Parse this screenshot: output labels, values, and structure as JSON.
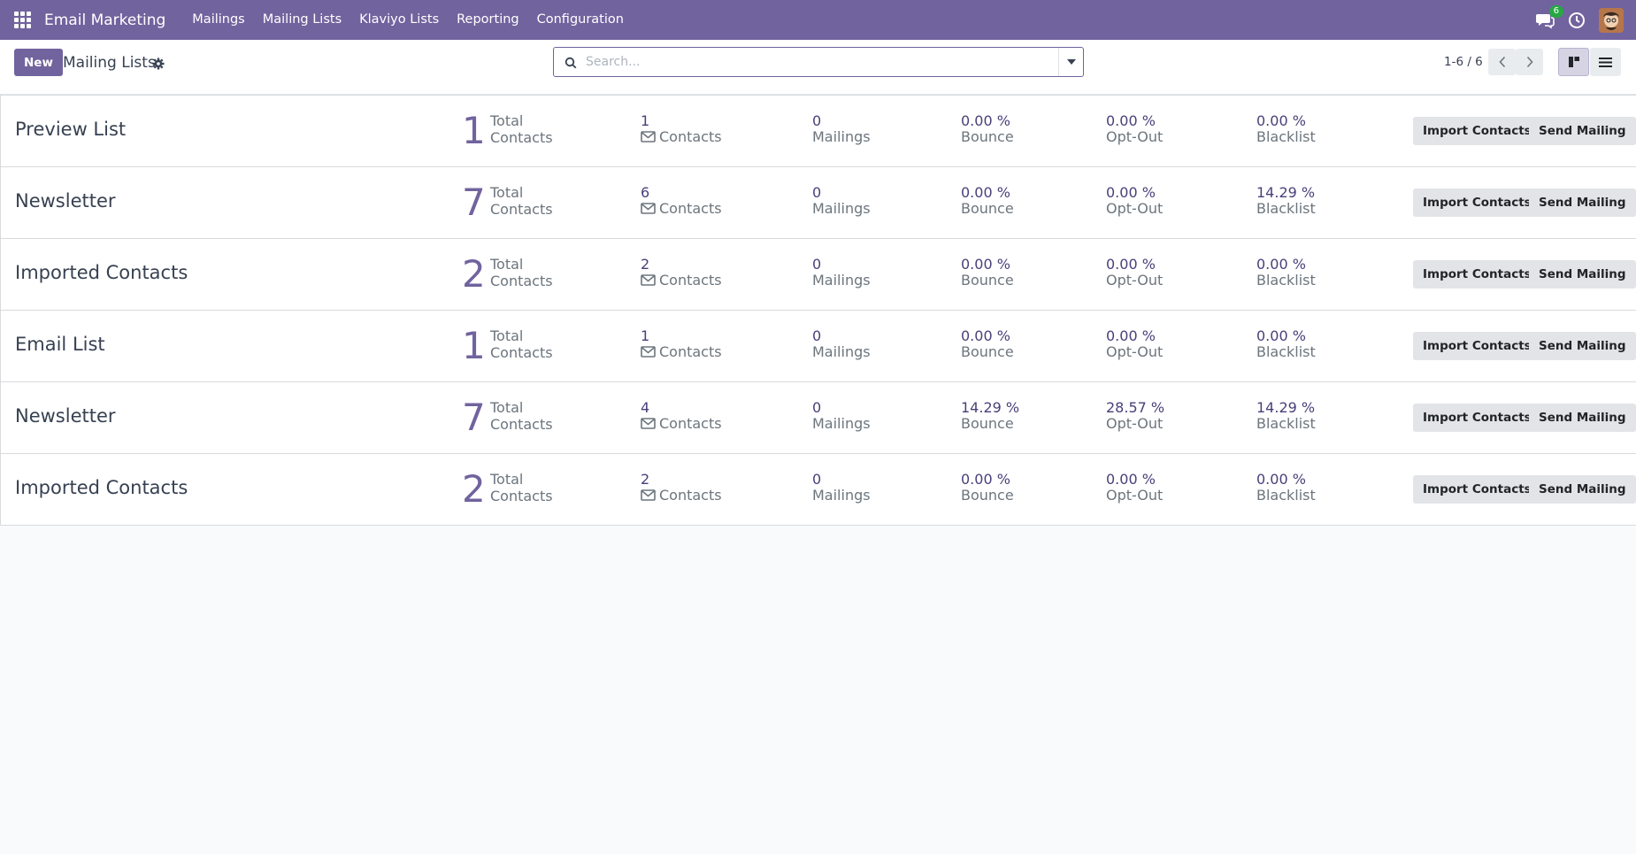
{
  "navbar": {
    "brand": "Email Marketing",
    "menu": [
      "Mailings",
      "Mailing Lists",
      "Klaviyo Lists",
      "Reporting",
      "Configuration"
    ],
    "chat_badge": "6",
    "bg_color": "#71639e"
  },
  "control": {
    "new_label": "New",
    "breadcrumb": "Mailing Lists",
    "search_placeholder": "Search...",
    "pager": "1-6 / 6"
  },
  "labels": {
    "total": "Total",
    "contacts": "Contacts",
    "mailings": "Mailings",
    "bounce": "Bounce",
    "optout": "Opt-Out",
    "blacklist": "Blacklist",
    "import_btn": "Import Contacts",
    "send_btn": "Send Mailing"
  },
  "rows": [
    {
      "name": "Preview List",
      "total": "1",
      "contacts": "1",
      "mailings": "0",
      "bounce": "0.00 %",
      "optout": "0.00 %",
      "blacklist": "0.00 %"
    },
    {
      "name": "Newsletter",
      "total": "7",
      "contacts": "6",
      "mailings": "0",
      "bounce": "0.00 %",
      "optout": "0.00 %",
      "blacklist": "14.29 %"
    },
    {
      "name": "Imported Contacts",
      "total": "2",
      "contacts": "2",
      "mailings": "0",
      "bounce": "0.00 %",
      "optout": "0.00 %",
      "blacklist": "0.00 %"
    },
    {
      "name": "Email List",
      "total": "1",
      "contacts": "1",
      "mailings": "0",
      "bounce": "0.00 %",
      "optout": "0.00 %",
      "blacklist": "0.00 %"
    },
    {
      "name": "Newsletter",
      "total": "7",
      "contacts": "4",
      "mailings": "0",
      "bounce": "14.29 %",
      "optout": "28.57 %",
      "blacklist": "14.29 %"
    },
    {
      "name": "Imported Contacts",
      "total": "2",
      "contacts": "2",
      "mailings": "0",
      "bounce": "0.00 %",
      "optout": "0.00 %",
      "blacklist": "0.00 %"
    }
  ]
}
